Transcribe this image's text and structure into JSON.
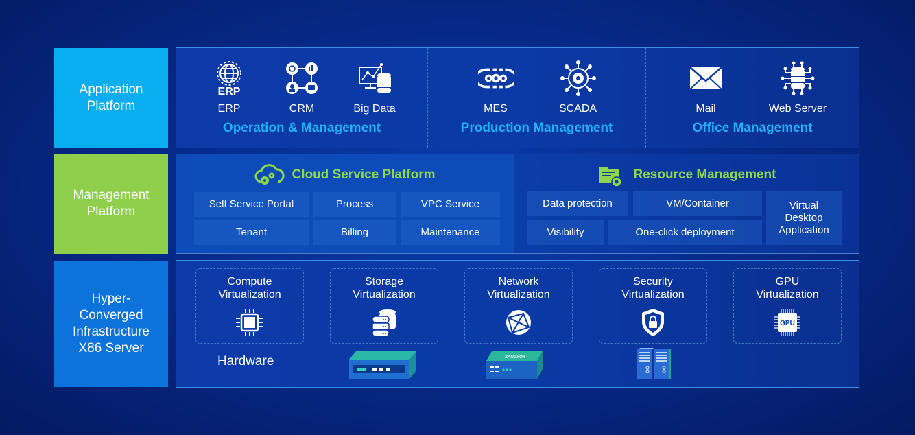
{
  "layers": {
    "application": {
      "label": "Application\nPlatform",
      "color": "#08aeef"
    },
    "management": {
      "label": "Management\nPlatform",
      "color": "#8fcf4c"
    },
    "infrastructure": {
      "label": "Hyper-\nConverged\nInfrastructure\nX86 Server",
      "color": "#0b73db"
    }
  },
  "application_platform": {
    "groups": [
      {
        "title": "Operation & Management",
        "items": [
          {
            "name": "ERP",
            "icon": "erp-globe-gear-icon"
          },
          {
            "name": "CRM",
            "icon": "crm-network-icon"
          },
          {
            "name": "Big Data",
            "icon": "big-data-monitor-database-icon"
          }
        ]
      },
      {
        "title": "Production Management",
        "items": [
          {
            "name": "MES",
            "icon": "mes-gears-cycle-icon"
          },
          {
            "name": "SCADA",
            "icon": "scada-gear-network-icon"
          }
        ]
      },
      {
        "title": "Office Management",
        "items": [
          {
            "name": "Mail",
            "icon": "mail-envelope-icon"
          },
          {
            "name": "Web Server",
            "icon": "web-server-database-circuit-icon"
          }
        ]
      }
    ],
    "title_color": "#1fb1f5"
  },
  "management_platform": {
    "cloud_service": {
      "title": "Cloud Service Platform",
      "icon": "cloud-gears-icon",
      "cells": [
        "Self Service Portal",
        "Process",
        "VPC  Service",
        "Tenant",
        "Billing",
        "Maintenance"
      ]
    },
    "resource_management": {
      "title": "Resource Management",
      "icon": "folder-gear-icon",
      "cells": [
        "Data protection",
        "VM/Container",
        "Virtual\nDesktop\nApplication",
        "Visibility",
        "One-click deployment"
      ]
    },
    "title_color": "#8fd64d"
  },
  "infrastructure": {
    "virtualizations": [
      {
        "title": "Compute\nVirtualization",
        "icon": "cpu-chip-icon"
      },
      {
        "title": "Storage\nVirtualization",
        "icon": "database-stack-icon"
      },
      {
        "title": "Network\nVirtualization",
        "icon": "network-globe-icon"
      },
      {
        "title": "Security\nVirtualization",
        "icon": "shield-lock-icon"
      },
      {
        "title": "GPU\nVirtualization",
        "icon": "gpu-chip-icon"
      }
    ],
    "hardware_label": "Hardware",
    "devices": [
      {
        "name": "server-appliance",
        "icon": "server-appliance-icon"
      },
      {
        "name": "branded-gateway",
        "brand_text": "SANGFOR",
        "icon": "gateway-appliance-icon"
      },
      {
        "name": "rack-cabinets",
        "icon": "rack-cabinet-icon"
      }
    ]
  }
}
